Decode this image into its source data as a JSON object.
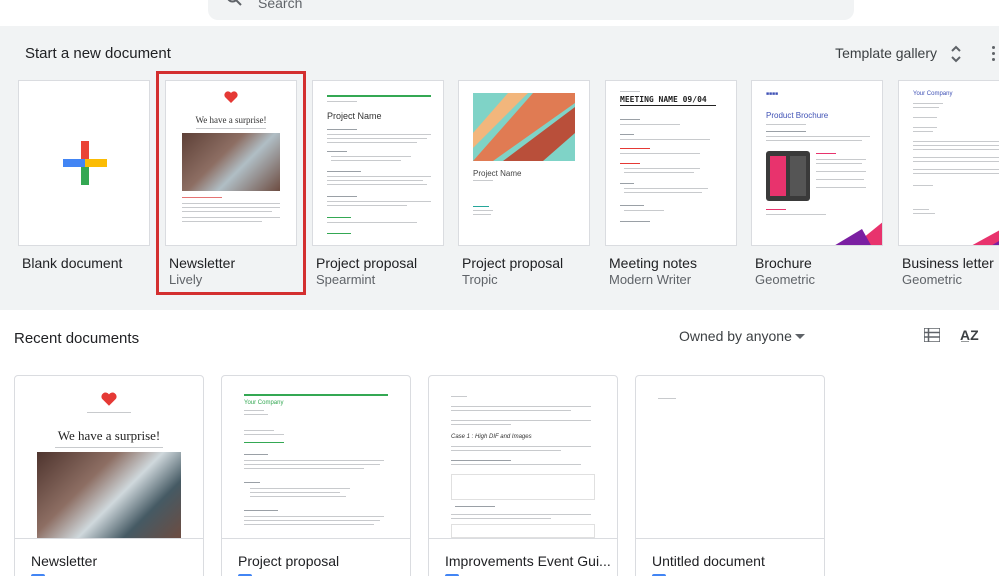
{
  "search": {
    "placeholder": "Search"
  },
  "templates": {
    "heading": "Start a new document",
    "gallery_label": "Template gallery",
    "items": [
      {
        "name": "Blank document",
        "subtitle": ""
      },
      {
        "name": "Newsletter",
        "subtitle": "Lively",
        "preview_title": "We have a surprise!"
      },
      {
        "name": "Project proposal",
        "subtitle": "Spearmint",
        "preview_title": "Project Name"
      },
      {
        "name": "Project proposal",
        "subtitle": "Tropic",
        "preview_title": "Project Name"
      },
      {
        "name": "Meeting notes",
        "subtitle": "Modern Writer",
        "preview_title": "MEETING NAME 09/04"
      },
      {
        "name": "Brochure",
        "subtitle": "Geometric",
        "preview_title": "Product Brochure"
      },
      {
        "name": "Business letter",
        "subtitle": "Geometric",
        "preview_title": "Your Company"
      }
    ],
    "selected_index": 1
  },
  "recent": {
    "heading": "Recent documents",
    "owner_filter": "Owned by anyone",
    "docs": [
      {
        "name": "Newsletter",
        "preview_title": "We have a surprise!"
      },
      {
        "name": "Project proposal",
        "preview_title": "Your Company"
      },
      {
        "name": "Improvements Event Gui...",
        "preview_title": "Case 1 : High DIF and Images"
      },
      {
        "name": "Untitled document",
        "preview_title": ""
      }
    ]
  },
  "colors": {
    "accent_red": "#d32f2f",
    "doc_blue": "#4285f4",
    "spearmint_green": "#34a853",
    "brochure_magenta": "#e8336d"
  },
  "icons": [
    "search-icon",
    "plus-icon",
    "unfold-icon",
    "more-vert-icon",
    "list-view-icon",
    "sort-az-icon",
    "heart-icon",
    "docs-icon"
  ]
}
